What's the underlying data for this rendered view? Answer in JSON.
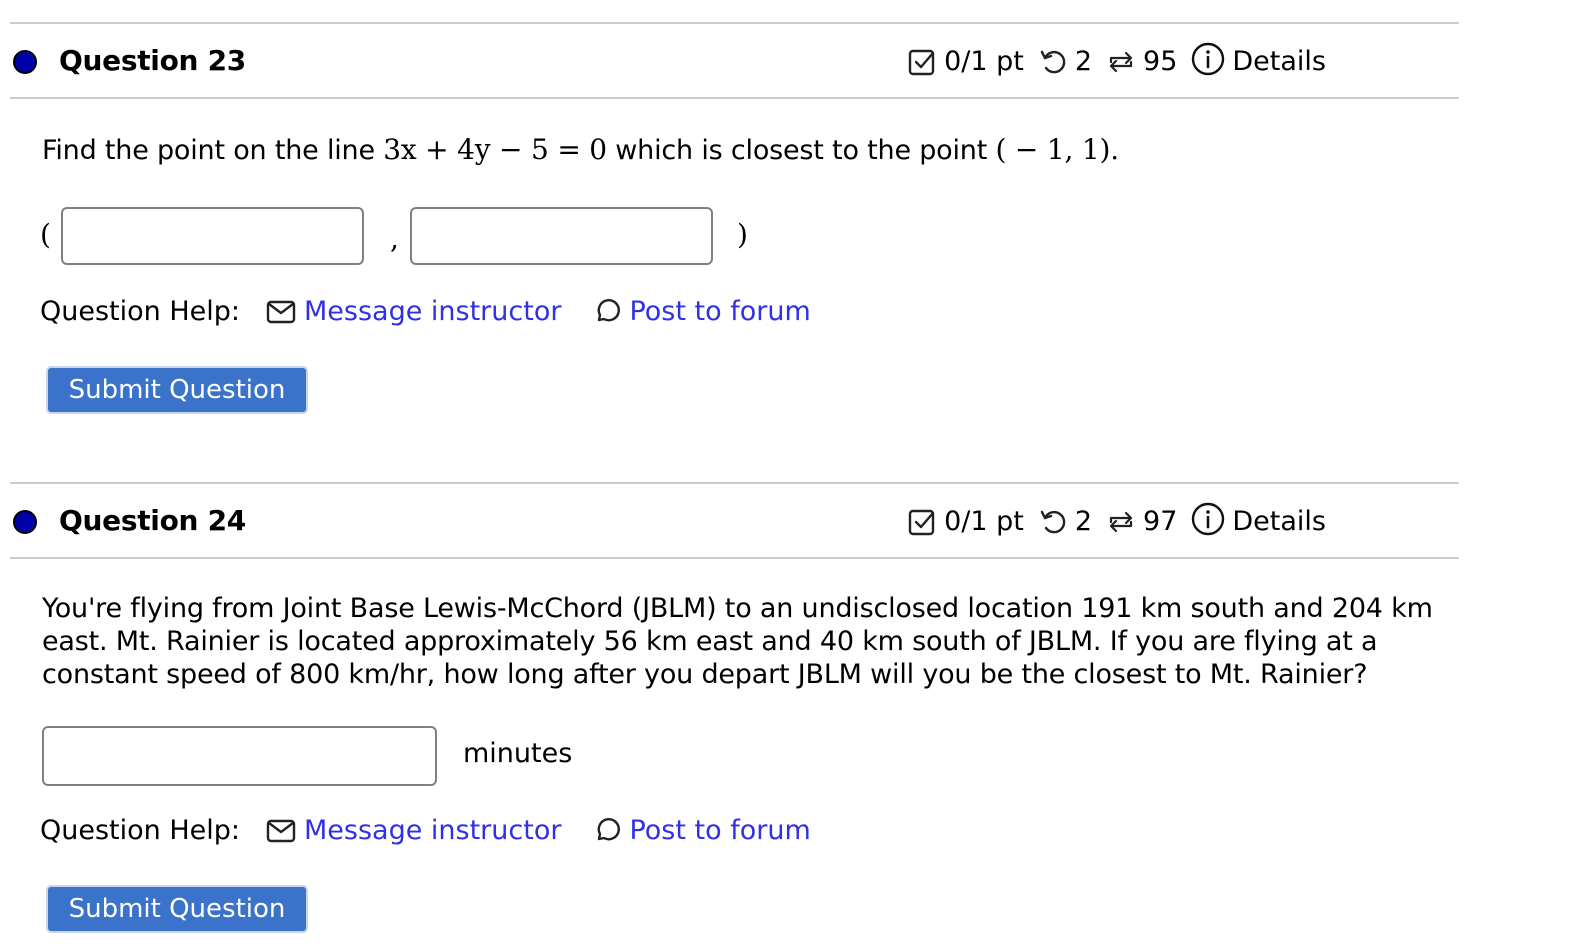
{
  "questions": [
    {
      "title": "Question 23",
      "status_color": "#0000a8",
      "score": "0/1 pt",
      "retries": "2",
      "attempts": "95",
      "details_label": "Details",
      "prompt_before": "Find the point on the line ",
      "prompt_math": "3x + 4y − 5 = 0",
      "prompt_after": " which is closest to the point ",
      "prompt_point": "( − 1, 1).",
      "open_paren": "(",
      "comma": ",",
      "close_paren": ")",
      "answer_x_value": "",
      "answer_y_value": "",
      "help_label": "Question Help:",
      "message_label": "Message instructor",
      "forum_label": "Post to forum",
      "submit_label": "Submit Question"
    },
    {
      "title": "Question 24",
      "status_color": "#0000a8",
      "score": "0/1 pt",
      "retries": "2",
      "attempts": "97",
      "details_label": "Details",
      "prompt_lines": [
        "You're flying from Joint Base Lewis-McChord (JBLM) to an undisclosed location 191 km south and 204 km",
        "east. Mt. Rainier is located approximately 56 km east and 40 km south of JBLM. If you are flying at a",
        "constant speed of 800 km/hr, how long after you depart JBLM will you be the closest to Mt. Rainier?"
      ],
      "answer_value": "",
      "unit_label": "minutes",
      "help_label": "Question Help:",
      "message_label": "Message instructor",
      "forum_label": "Post to forum",
      "submit_label": "Submit Question"
    }
  ],
  "colors": {
    "link": "#3030e6",
    "submit_bg": "#3a73c9",
    "divider": "#cccccc"
  }
}
